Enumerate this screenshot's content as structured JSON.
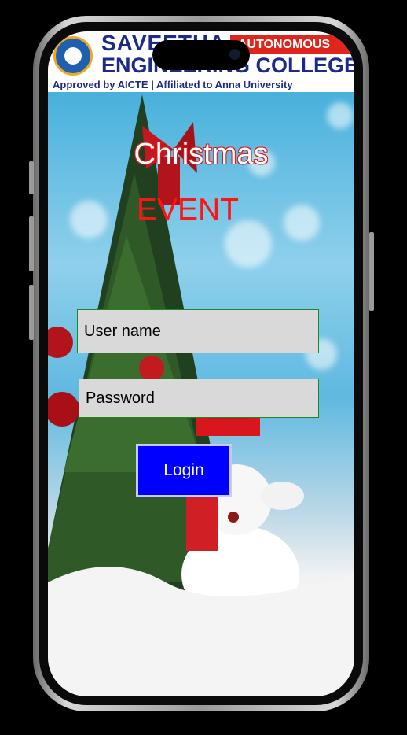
{
  "banner": {
    "line1": "SAVEETHA",
    "line2": "ENGINEERING COLLEGE",
    "tag": "AUTONOMOUS",
    "subline": "Approved by AICTE  |  Affiliated to Anna University"
  },
  "event": {
    "title": "Christmas",
    "subtitle": "EVENT"
  },
  "form": {
    "username_placeholder": "User name",
    "password_placeholder": "Password",
    "login_label": "Login"
  },
  "colors": {
    "title_outline": "#d81c1c",
    "subtitle": "#ff1414",
    "field_border": "#1b8a1b",
    "field_bg": "#d9d9d9",
    "login_bg": "#0000ff",
    "banner_text": "#1d2a8a",
    "tag_bg": "#e0261c"
  }
}
